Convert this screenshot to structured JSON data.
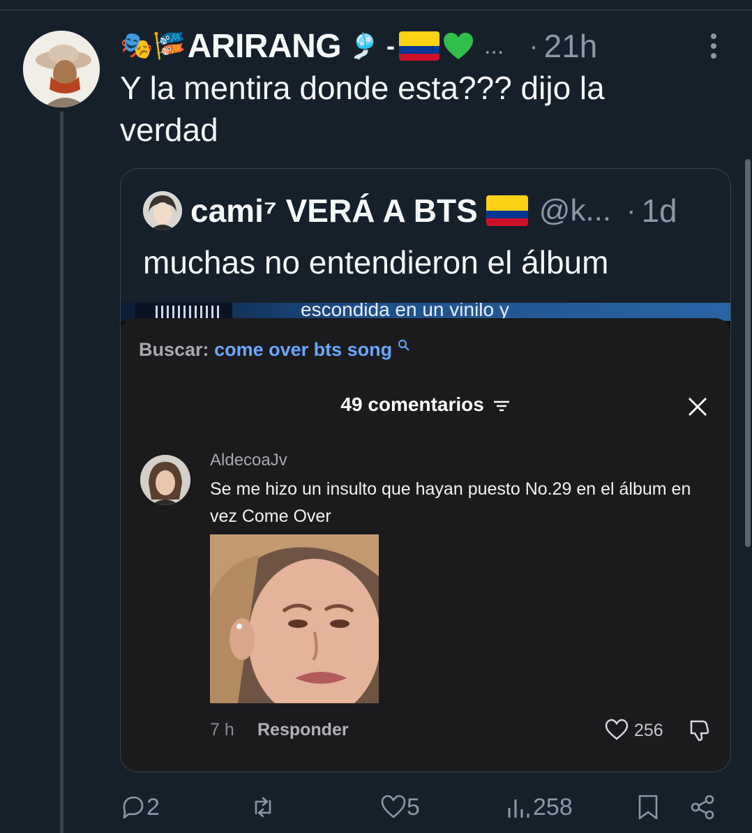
{
  "tweet": {
    "author": {
      "emoji_prefix": "🎭🎏",
      "display_name": "ARIRANG",
      "emoji_suffix": "🎐 -",
      "flag": "colombia-flag",
      "heart": "green-heart",
      "truncation": "...",
      "separator": "·",
      "time": "21h"
    },
    "text_line1": "Y la mentira donde esta??? dijo la",
    "text_line2": "verdad"
  },
  "quote": {
    "author": {
      "display_name": "cami⁷ VERÁ A BTS",
      "flag": "colombia-flag",
      "handle": "@k...",
      "separator": "·",
      "time": "1d"
    },
    "text": "muchas no entendieron el álbum",
    "media": {
      "banner_text": "escondida en un vinilo y",
      "search_label": "Buscar:",
      "search_query": "come over bts song",
      "comments_title": "49 comentarios",
      "comment": {
        "username": "AldecoaJv",
        "text": "Se me hizo un insulto que hayan puesto No.29 en el álbum en vez Come Over",
        "time": "7 h",
        "reply_label": "Responder",
        "likes": "256"
      }
    }
  },
  "actions": {
    "replies": "2",
    "reposts": "",
    "likes": "5",
    "views": "258"
  },
  "colors": {
    "background": "#15202b",
    "border": "#38444d",
    "muted": "#8b98a5",
    "search_query": "#6aa7ff",
    "flag_yellow": "#fcd116",
    "flag_blue": "#003893",
    "flag_red": "#ce1126",
    "heart_green": "#2fbf4a"
  }
}
